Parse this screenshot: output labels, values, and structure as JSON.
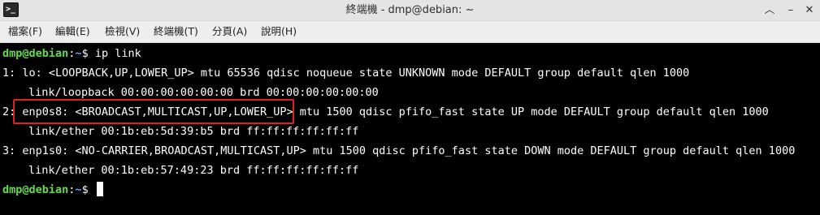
{
  "window": {
    "title": "終端機 - dmp@debian: ~",
    "app_icon_glyph": ">_",
    "controls": {
      "up": "︿",
      "minimize": "–",
      "close": "✕"
    }
  },
  "menu": [
    {
      "label": "檔案(F)"
    },
    {
      "label": "編輯(E)"
    },
    {
      "label": "檢視(V)"
    },
    {
      "label": "終端機(T)"
    },
    {
      "label": "分頁(A)"
    },
    {
      "label": "說明(H)"
    }
  ],
  "terminal": {
    "prompt_user": "dmp@debian",
    "prompt_sep": ":",
    "prompt_path": "~",
    "prompt_end": "$ ",
    "command": "ip link",
    "output": [
      "1: lo: <LOOPBACK,UP,LOWER_UP> mtu 65536 qdisc noqueue state UNKNOWN mode DEFAULT group default qlen 1000",
      "link/loopback 00:00:00:00:00:00 brd 00:00:00:00:00:00",
      "2: enp0s8: <BROADCAST,MULTICAST,UP,LOWER_UP> mtu 1500 qdisc pfifo_fast state UP mode DEFAULT group default qlen 1000",
      "link/ether 00:1b:eb:5d:39:b5 brd ff:ff:ff:ff:ff:ff",
      "3: enp1s0: <NO-CARRIER,BROADCAST,MULTICAST,UP> mtu 1500 qdisc pfifo_fast state DOWN mode DEFAULT group default qlen 1000",
      "link/ether 00:1b:eb:57:49:23 brd ff:ff:ff:ff:ff:ff"
    ]
  },
  "colors": {
    "terminal_bg": "#000000",
    "terminal_fg": "#ffffff",
    "prompt_user": "#66d950",
    "prompt_path": "#6f9aff",
    "highlight_box": "#e02020"
  }
}
